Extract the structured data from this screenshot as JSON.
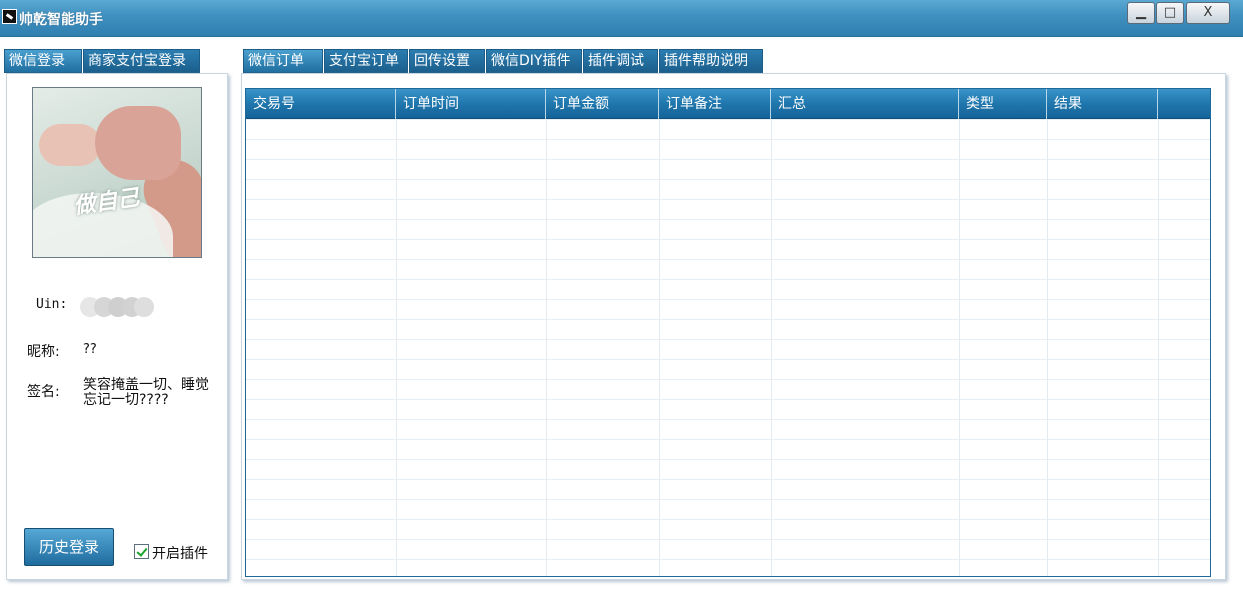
{
  "window": {
    "title": "帅乾智能助手",
    "controls": {
      "minimize": "▁",
      "maximize": "□",
      "close": "X"
    }
  },
  "left_tabs": [
    {
      "label": "微信登录",
      "active": true
    },
    {
      "label": "商家支付宝登录",
      "active": false
    }
  ],
  "profile": {
    "avatar_icon": "fist-bump-avatar",
    "avatar_overlay_text": "做自己",
    "vin_label": "Uin:",
    "nickname_label": "昵称:",
    "nickname_value": "??",
    "signature_label": "签名:",
    "signature_value": "笑容掩盖一切、睡觉忘记一切????"
  },
  "history_button": "历史登录",
  "plugin_toggle": {
    "label": "开启插件",
    "checked": true
  },
  "right_tabs": [
    {
      "label": "微信订单",
      "active": true
    },
    {
      "label": "支付宝订单",
      "active": false
    },
    {
      "label": "回传设置",
      "active": false
    },
    {
      "label": "微信DIY插件",
      "active": false
    },
    {
      "label": "插件调试",
      "active": false
    },
    {
      "label": "插件帮助说明",
      "active": false
    }
  ],
  "orders_table": {
    "columns": [
      "交易号",
      "订单时间",
      "订单金额",
      "订单备注",
      "汇总",
      "类型",
      "结果",
      ""
    ],
    "rows": []
  },
  "colors": {
    "titlebar": "#3f8fbf",
    "tab_active": "#4aa0cf",
    "header": "#1f77ad",
    "checkmark": "#1aa32a"
  }
}
